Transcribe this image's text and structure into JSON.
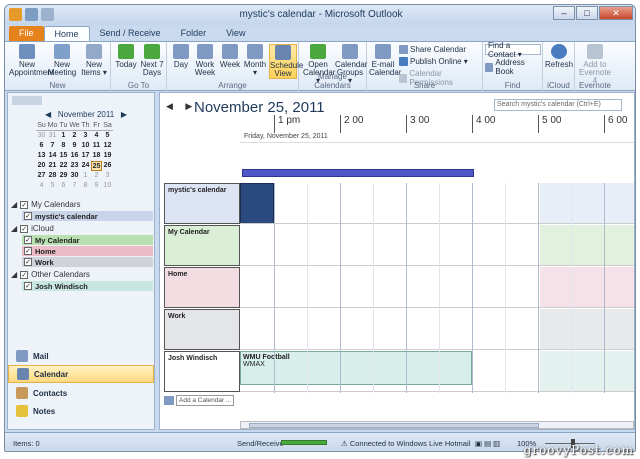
{
  "window": {
    "title": "mystic's calendar - ",
    "app": "Microsoft Outlook",
    "controls": {
      "minimize": "–",
      "maximize": "□",
      "close": "✕",
      "help": "?"
    }
  },
  "tabs": [
    "File",
    "Home",
    "Send / Receive",
    "Folder",
    "View"
  ],
  "ribbon": {
    "new_group": {
      "label": "New",
      "new_appointment": "New Appointment",
      "new_meeting": "New Meeting",
      "new_items": "New Items ▾"
    },
    "goto_group": {
      "label": "Go To",
      "today": "Today",
      "next7": "Next 7 Days"
    },
    "arrange_group": {
      "label": "Arrange",
      "day": "Day",
      "work_week": "Work Week",
      "week": "Week",
      "month": "Month ▾",
      "schedule_view": "Schedule View"
    },
    "manage_group": {
      "label": "Manage Calendars",
      "open_calendar": "Open Calendar ▾",
      "calendar_groups": "Calendar Groups ▾"
    },
    "share_group": {
      "label": "Share",
      "email_calendar": "E-mail Calendar",
      "share_calendar": "Share Calendar",
      "publish_online": "Publish Online ▾",
      "calendar_permissions": "Calendar Permissions"
    },
    "find_group": {
      "label": "Find",
      "find_contact": "Find a Contact ▾",
      "address_book": "Address Book"
    },
    "icloud_group": {
      "label": "iCloud",
      "refresh": "Refresh"
    },
    "evernote_group": {
      "label": "Evernote",
      "add": "Add to Evernote 4"
    }
  },
  "minical": {
    "month": "November 2011",
    "dow": [
      "Su",
      "Mo",
      "Tu",
      "We",
      "Th",
      "Fr",
      "Sa"
    ],
    "weeks": [
      [
        "30",
        "31",
        "1",
        "2",
        "3",
        "4",
        "5"
      ],
      [
        "6",
        "7",
        "8",
        "9",
        "10",
        "11",
        "12"
      ],
      [
        "13",
        "14",
        "15",
        "16",
        "17",
        "18",
        "19"
      ],
      [
        "20",
        "21",
        "22",
        "23",
        "24",
        "25",
        "26"
      ],
      [
        "27",
        "28",
        "29",
        "30",
        "1",
        "2",
        "3"
      ],
      [
        "4",
        "5",
        "6",
        "7",
        "8",
        "9",
        "10"
      ]
    ]
  },
  "calendars": {
    "my_calendars": "My Calendars",
    "mystic": "mystic's calendar",
    "icloud": "iCloud",
    "my_calendar": "My Calendar",
    "home": "Home",
    "work": "Work",
    "other_calendars": "Other Calendars",
    "josh": "Josh Windisch"
  },
  "nav": {
    "mail": "Mail",
    "calendar": "Calendar",
    "contacts": "Contacts",
    "notes": "Notes"
  },
  "day_view": {
    "date_title": "November 25, 2011",
    "search_placeholder": "Search mystic's calendar (Ctrl+E)",
    "date_label": "Friday, November 25, 2011",
    "hours": [
      "1 pm",
      "2 00",
      "3 00",
      "4 00",
      "5 00",
      "6 00"
    ],
    "rows": [
      "mystic's calendar",
      "My Calendar",
      "Home",
      "Work",
      "Josh Windisch"
    ],
    "event_title": "WMU Football",
    "event_location": "WMAX",
    "add_calendar": "Add a Calendar ..."
  },
  "status": {
    "items": "Items: 0",
    "send_receive": "Send/Receive",
    "connection": "Connected to Windows Live Hotmail",
    "zoom": "100%"
  },
  "watermark": "groovyPost.com"
}
